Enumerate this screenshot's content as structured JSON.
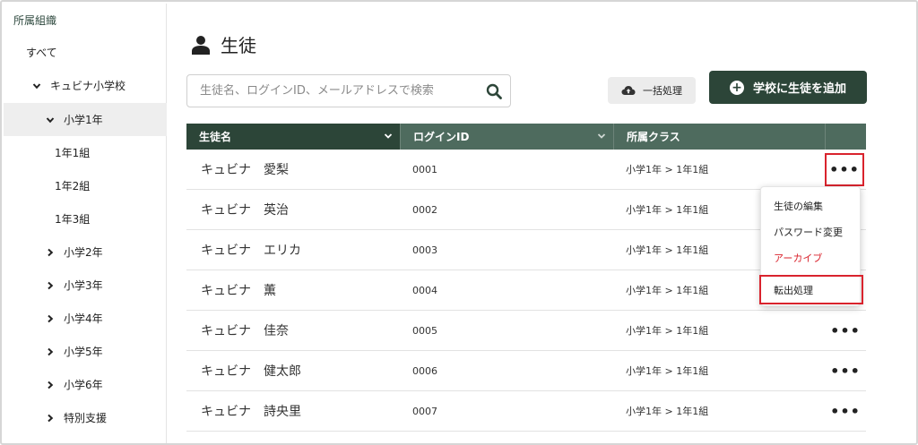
{
  "sidebar": {
    "header": "所属組織",
    "items": [
      {
        "label": "すべて",
        "chevron": "none",
        "indent": 0
      },
      {
        "label": "キュビナ小学校",
        "chevron": "down",
        "indent": 1
      },
      {
        "label": "小学1年",
        "chevron": "down",
        "indent": 2,
        "selected": true
      },
      {
        "label": "1年1組",
        "chevron": "none",
        "indent": 3
      },
      {
        "label": "1年2組",
        "chevron": "none",
        "indent": 3
      },
      {
        "label": "1年3組",
        "chevron": "none",
        "indent": 3
      },
      {
        "label": "小学2年",
        "chevron": "right",
        "indent": 2
      },
      {
        "label": "小学3年",
        "chevron": "right",
        "indent": 2
      },
      {
        "label": "小学4年",
        "chevron": "right",
        "indent": 2
      },
      {
        "label": "小学5年",
        "chevron": "right",
        "indent": 2
      },
      {
        "label": "小学6年",
        "chevron": "right",
        "indent": 2
      },
      {
        "label": "特別支援",
        "chevron": "right",
        "indent": 2
      }
    ]
  },
  "page": {
    "title": "生徒",
    "icon": "user-icon"
  },
  "search": {
    "placeholder": "生徒名、ログインID、メールアドレスで検索",
    "value": "",
    "icon": "search-icon"
  },
  "toolbar": {
    "bulk_label": "一括処理",
    "bulk_icon": "cloud-upload-icon",
    "add_label": "学校に生徒を追加",
    "add_icon": "plus-circle-icon"
  },
  "table": {
    "headers": [
      "生徒名",
      "ログインID",
      "所属クラス"
    ],
    "rows": [
      {
        "name": "キュビナ　愛梨",
        "login_id": "0001",
        "class": "小学1年 > 1年1組"
      },
      {
        "name": "キュビナ　英治",
        "login_id": "0002",
        "class": "小学1年 > 1年1組"
      },
      {
        "name": "キュビナ　エリカ",
        "login_id": "0003",
        "class": "小学1年 > 1年1組"
      },
      {
        "name": "キュビナ　薫",
        "login_id": "0004",
        "class": "小学1年 > 1年1組"
      },
      {
        "name": "キュビナ　佳奈",
        "login_id": "0005",
        "class": "小学1年 > 1年1組"
      },
      {
        "name": "キュビナ　健太郎",
        "login_id": "0006",
        "class": "小学1年 > 1年1組"
      },
      {
        "name": "キュビナ　詩央里",
        "login_id": "0007",
        "class": "小学1年 > 1年1組"
      }
    ],
    "more_label": "•••"
  },
  "row_menu": {
    "items": [
      {
        "label": "生徒の編集",
        "color": "#222222"
      },
      {
        "label": "パスワード変更",
        "color": "#222222"
      },
      {
        "label": "アーカイブ",
        "color": "#d9232d"
      },
      {
        "label": "転出処理",
        "color": "#222222"
      }
    ]
  },
  "colors": {
    "accent": "#2c4538",
    "header_secondary": "#4e6b5e",
    "highlight": "#d9232d"
  }
}
